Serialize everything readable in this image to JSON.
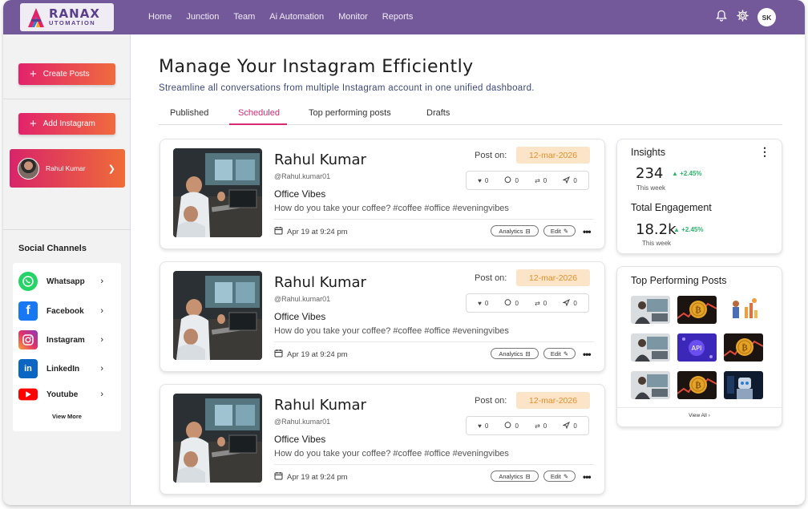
{
  "brand": {
    "name": "RANAX",
    "sub": "UTOMATION"
  },
  "nav": {
    "items": [
      "Home",
      "Junction",
      "Team",
      "Ai Automation",
      "Monitor",
      "Reports"
    ],
    "user_initials": "SK",
    "icons": [
      "bell-icon",
      "gear-icon"
    ]
  },
  "sidebar": {
    "create_posts": "Create Posts",
    "add_instagram": "Add Instagram",
    "profile_name": "Rahul Kumar",
    "channels_title": "Social Channels",
    "channels": [
      {
        "label": "Whatsapp",
        "color": "#25d366"
      },
      {
        "label": "Facebook",
        "color": "#1877f2"
      },
      {
        "label": "Instagram",
        "color": "#e1306c"
      },
      {
        "label": "LinkedIn",
        "color": "#0a66c2"
      },
      {
        "label": "Youtube",
        "color": "#ff0000"
      }
    ],
    "view_more": "View More"
  },
  "main": {
    "title": "Manage Your Instagram Efficiently",
    "subtitle": "Streamline all conversations from multiple Instagram account in one unified dashboard.",
    "tabs": [
      "Published",
      "Scheduled",
      "Top performing posts",
      "Drafts"
    ],
    "active_tab": "Scheduled",
    "posts": [
      {
        "name": "Rahul Kumar",
        "handle": "@Rahul.kumar01",
        "heading": "Office Vibes",
        "caption": "How do you take your coffee? #coffee #office #eveningvibes",
        "date": "Apr 19 at 9:24 pm",
        "post_on": "Post on:",
        "scheduled": "12-mar-2026",
        "likes": "0",
        "comments": "0",
        "reposts": "0",
        "shares": "0",
        "analytics": "Analytics",
        "edit": "Edit"
      },
      {
        "name": "Rahul Kumar",
        "handle": "@Rahul.kumar01",
        "heading": "Office Vibes",
        "caption": "How do you take your coffee? #coffee #office #eveningvibes",
        "date": "Apr 19 at 9:24 pm",
        "post_on": "Post on:",
        "scheduled": "12-mar-2026",
        "likes": "0",
        "comments": "0",
        "reposts": "0",
        "shares": "0",
        "analytics": "Analytics",
        "edit": "Edit"
      },
      {
        "name": "Rahul Kumar",
        "handle": "@Rahul.kumar01",
        "heading": "Office Vibes",
        "caption": "How do you take your coffee? #coffee #office #eveningvibes",
        "date": "Apr 19 at 9:24 pm",
        "post_on": "Post on:",
        "scheduled": "12-mar-2026",
        "likes": "0",
        "comments": "0",
        "reposts": "0",
        "shares": "0",
        "analytics": "Analytics",
        "edit": "Edit"
      }
    ]
  },
  "insights": {
    "title": "Insights",
    "followers": "234",
    "followers_growth": "+2.45%",
    "followers_period": "This week",
    "engagement_title": "Total Engagement",
    "engagement": "18.2k",
    "engagement_growth": "+2.45%",
    "engagement_period": "This week"
  },
  "top_posts": {
    "title": "Top Performing Posts",
    "view_all": "View All",
    "thumbnails": [
      "office",
      "bitcoin",
      "analytics-illustration",
      "office",
      "api",
      "bitcoin",
      "office",
      "bitcoin",
      "robot"
    ]
  },
  "colors": {
    "nav_bg": "#73589a",
    "accent_pink": "#d62a73",
    "gradient_start": "#e2236b",
    "gradient_end": "#f06b3e",
    "badge_bg": "#fbe4c7",
    "badge_text": "#e3902b",
    "growth": "#2bb36b"
  }
}
